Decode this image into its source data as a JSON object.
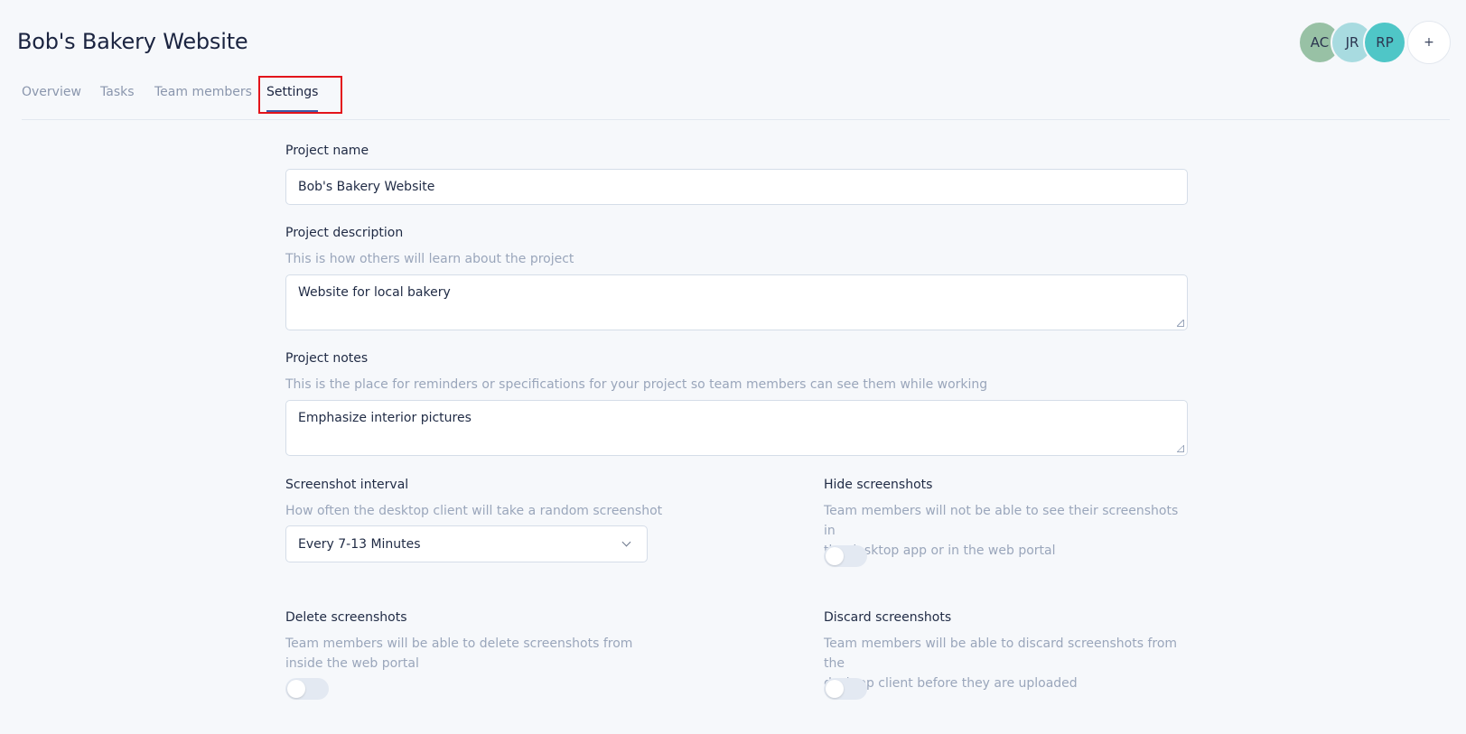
{
  "header": {
    "title": "Bob's Bakery Website",
    "avatars": [
      "AC",
      "JR",
      "RP"
    ],
    "add_label": "+"
  },
  "tabs": [
    {
      "label": "Overview"
    },
    {
      "label": "Tasks"
    },
    {
      "label": "Team members"
    },
    {
      "label": "Settings",
      "active": true
    }
  ],
  "form": {
    "project_name": {
      "label": "Project name",
      "value": "Bob's Bakery Website"
    },
    "project_description": {
      "label": "Project description",
      "help": "This is how others will learn about the project",
      "value": "Website for local bakery"
    },
    "project_notes": {
      "label": "Project notes",
      "help": "This is the place for reminders or specifications for your project so team members can see them while working",
      "value": "Emphasize interior pictures"
    },
    "screenshot_interval": {
      "label": "Screenshot interval",
      "help": "How often the desktop client will take a random screenshot",
      "selected": "Every 7-13 Minutes"
    },
    "hide_screenshots": {
      "label": "Hide screenshots",
      "help_line1": "Team members will not be able to see their screenshots in",
      "help_line2": "the desktop app or in the web portal",
      "enabled": false
    },
    "delete_screenshots": {
      "label": "Delete screenshots",
      "help_line1": "Team members will be able to delete screenshots from",
      "help_line2": "inside the web portal",
      "enabled": false
    },
    "discard_screenshots": {
      "label": "Discard screenshots",
      "help_line1": "Team members will be able to discard screenshots from the",
      "help_line2": "desktop client before they are uploaded",
      "enabled": false
    }
  },
  "colors": {
    "background": "#f6f8fb",
    "active_tab_underline": "#3e5ba8",
    "highlight_box": "#e3141b"
  }
}
